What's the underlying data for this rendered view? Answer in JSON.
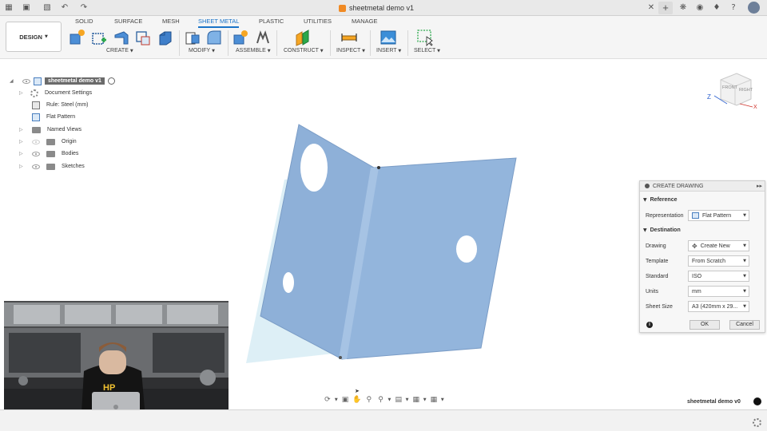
{
  "titlebar": {
    "document_title": "sheetmetal demo v1",
    "icons": [
      "apps-grid-icon",
      "file-icon",
      "save-icon",
      "undo-icon",
      "redo-icon",
      "close-icon",
      "plus-icon",
      "extensions-icon",
      "job-status-icon",
      "notifications-icon",
      "help-icon",
      "avatar"
    ]
  },
  "toolbar": {
    "workspace_label": "DESIGN",
    "tabs": [
      {
        "label": "SOLID",
        "active": false
      },
      {
        "label": "SURFACE",
        "active": false
      },
      {
        "label": "MESH",
        "active": false
      },
      {
        "label": "SHEET METAL",
        "active": true
      },
      {
        "label": "PLASTIC",
        "active": false
      },
      {
        "label": "UTILITIES",
        "active": false
      },
      {
        "label": "MANAGE",
        "active": false
      }
    ],
    "groups": [
      {
        "label": "CREATE",
        "icons": [
          "new-component-icon",
          "create-sketch-icon",
          "flange-icon",
          "create-base-feature-icon",
          "extrude-icon"
        ]
      },
      {
        "label": "MODIFY",
        "icons": [
          "press-pull-icon",
          "bend-icon"
        ]
      },
      {
        "label": "ASSEMBLE",
        "icons": [
          "new-component-assemble-icon",
          "joint-icon"
        ]
      },
      {
        "label": "CONSTRUCT",
        "icons": [
          "offset-plane-icon"
        ]
      },
      {
        "label": "INSPECT",
        "icons": [
          "measure-icon"
        ]
      },
      {
        "label": "INSERT",
        "icons": [
          "insert-image-icon"
        ]
      },
      {
        "label": "SELECT",
        "icons": [
          "select-icon"
        ]
      }
    ],
    "accent_color": "#1a73c8"
  },
  "browser": {
    "root": "sheetmetal demo v1",
    "items": [
      {
        "label": "Document Settings",
        "icon": "gear-icon"
      },
      {
        "label": "Rule: Steel (mm)",
        "icon": "sheet-metal-rule-icon"
      },
      {
        "label": "Flat Pattern",
        "icon": "flat-pattern-icon"
      },
      {
        "label": "Named Views",
        "icon": "folder-icon"
      },
      {
        "label": "Origin",
        "icon": "folder-icon"
      },
      {
        "label": "Bodies",
        "icon": "folder-icon"
      },
      {
        "label": "Sketches",
        "icon": "folder-icon"
      }
    ]
  },
  "viewcube": {
    "front": "FRONT",
    "right": "RIGHT",
    "z_axis": "Z",
    "x_axis": "X"
  },
  "model": {
    "body_color": "#8eb0d8",
    "shadow_color": "#d7ecf5"
  },
  "create_drawing": {
    "title": "CREATE DRAWING",
    "reference_label": "Reference",
    "representation_label": "Representation",
    "representation_value": "Flat Pattern",
    "destination_label": "Destination",
    "drawing_label": "Drawing",
    "drawing_value": "Create New",
    "template_label": "Template",
    "template_value": "From Scratch",
    "standard_label": "Standard",
    "standard_value": "ISO",
    "units_label": "Units",
    "units_value": "mm",
    "sheet_size_label": "Sheet Size",
    "sheet_size_value": "A3 (420mm x 29...",
    "ok_label": "OK",
    "cancel_label": "Cancel"
  },
  "navbar": {
    "icons": [
      "orbit-icon",
      "look-at-icon",
      "pan-icon",
      "zoom-icon",
      "fit-icon",
      "display-settings-icon",
      "grid-snap-icon",
      "viewports-icon"
    ]
  },
  "status": {
    "document_version": "sheetmetal demo v0"
  },
  "video_overlay": {
    "shirt_text": "HP"
  }
}
